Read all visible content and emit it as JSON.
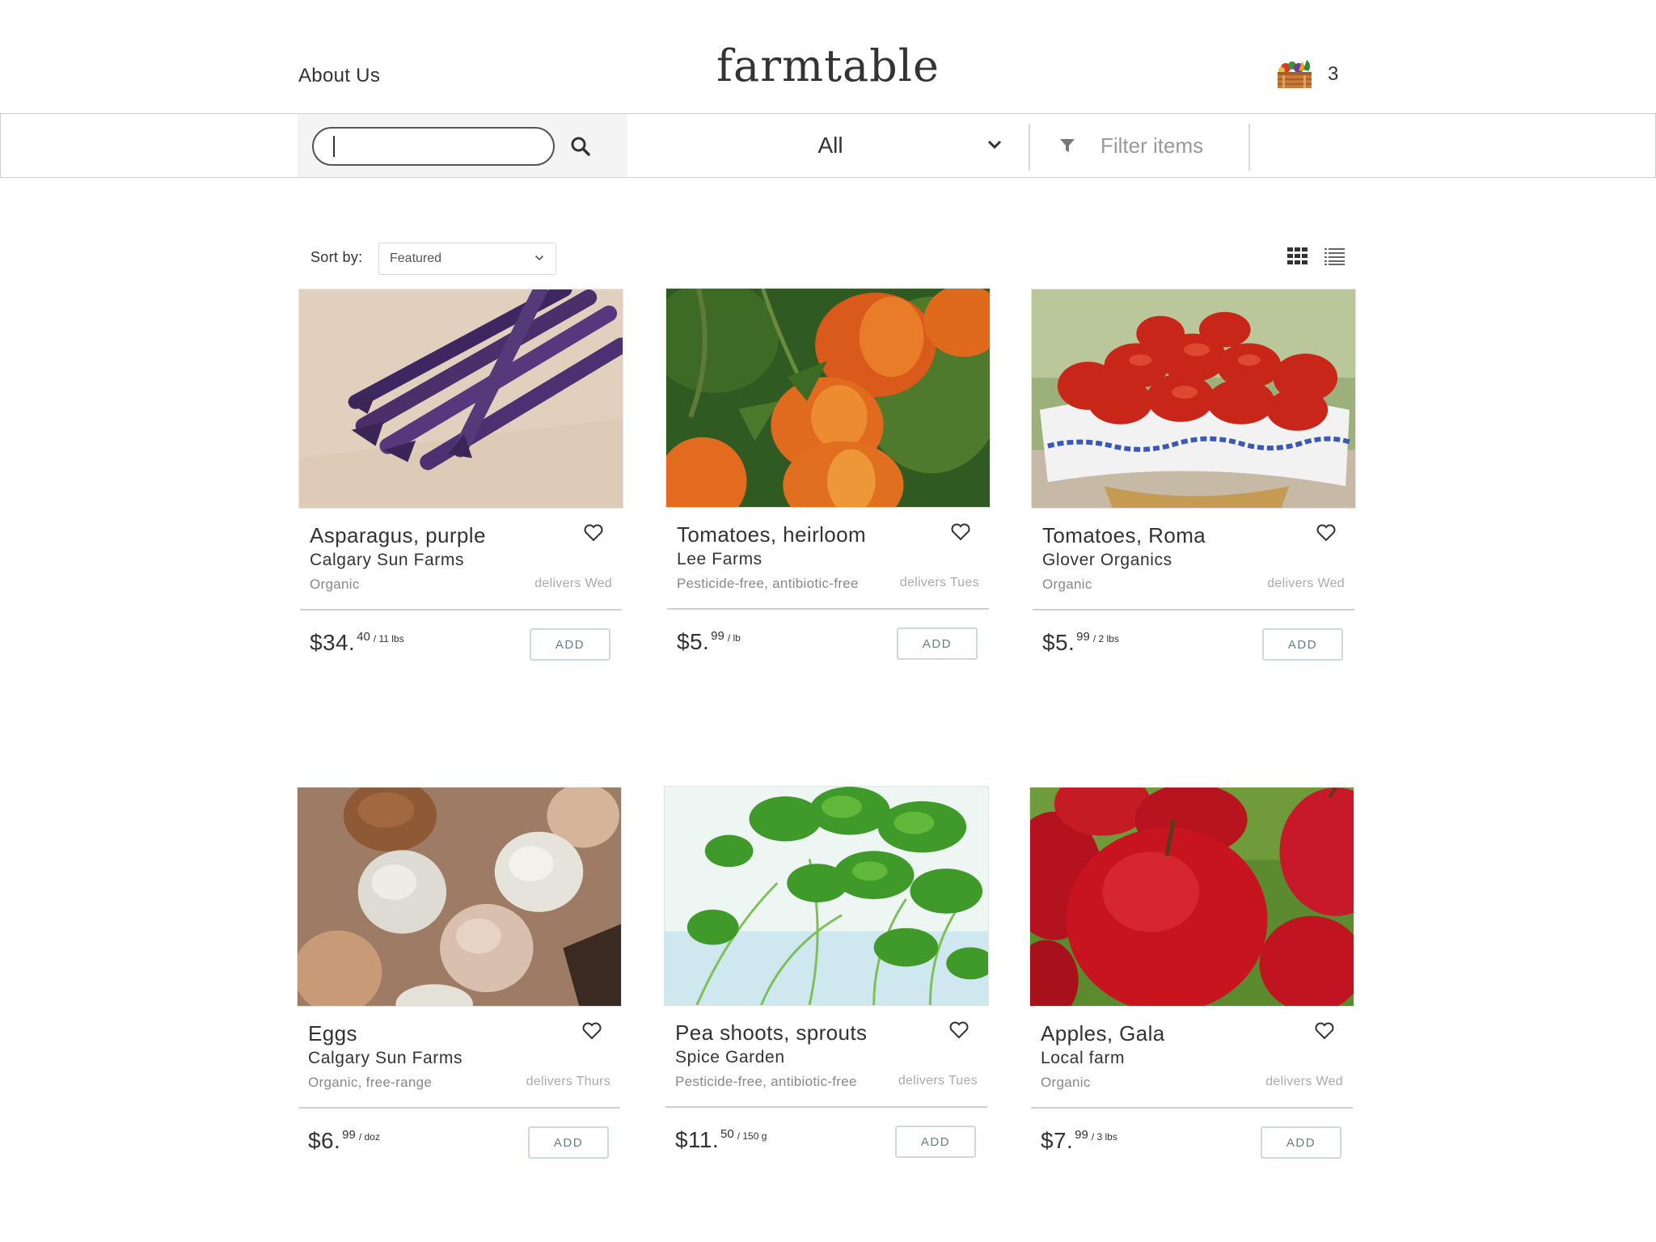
{
  "header": {
    "about_label": "About Us",
    "logo_text": "farmtable",
    "cart_count": "3"
  },
  "toolbar": {
    "search_value": "",
    "category_label": "All",
    "filter_label": "Filter items"
  },
  "sort": {
    "label": "Sort by:",
    "selected": "Featured"
  },
  "products": [
    {
      "name": "Asparagus, purple",
      "farm": "Calgary Sun Farms",
      "cert": "Organic",
      "delivers": "delivers Wed",
      "price_main": "$34.",
      "price_cents": "40",
      "price_unit": "/ 11 lbs",
      "add_label": "ADD",
      "image": "purple-asparagus"
    },
    {
      "name": "Tomatoes, heirloom",
      "farm": "Lee Farms",
      "cert": "Pesticide-free, antibiotic-free",
      "delivers": "delivers Tues",
      "price_main": "$5.",
      "price_cents": "99",
      "price_unit": "/ lb",
      "add_label": "ADD",
      "image": "heirloom-tomatoes"
    },
    {
      "name": "Tomatoes, Roma",
      "farm": "Glover Organics",
      "cert": "Organic",
      "delivers": "delivers Wed",
      "price_main": "$5.",
      "price_cents": "99",
      "price_unit": "/ 2 lbs",
      "add_label": "ADD",
      "image": "roma-tomatoes-basket"
    },
    {
      "name": "Eggs",
      "farm": "Calgary Sun Farms",
      "cert": "Organic, free-range",
      "delivers": "delivers Thurs",
      "price_main": "$6.",
      "price_cents": "99",
      "price_unit": "/ doz",
      "add_label": "ADD",
      "image": "eggs-carton"
    },
    {
      "name": "Pea shoots, sprouts",
      "farm": "Spice Garden",
      "cert": "Pesticide-free, antibiotic-free",
      "delivers": "delivers Tues",
      "price_main": "$11.",
      "price_cents": "50",
      "price_unit": "/ 150 g",
      "add_label": "ADD",
      "image": "pea-shoots"
    },
    {
      "name": "Apples, Gala",
      "farm": "Local farm",
      "cert": "Organic",
      "delivers": "delivers Wed",
      "price_main": "$7.",
      "price_cents": "99",
      "price_unit": "/ 3 lbs",
      "add_label": "ADD",
      "image": "gala-apples"
    }
  ],
  "colors": {
    "text": "#333333",
    "muted": "#888888",
    "add_border": "#cfd9dd",
    "add_text": "#6b7e86"
  }
}
